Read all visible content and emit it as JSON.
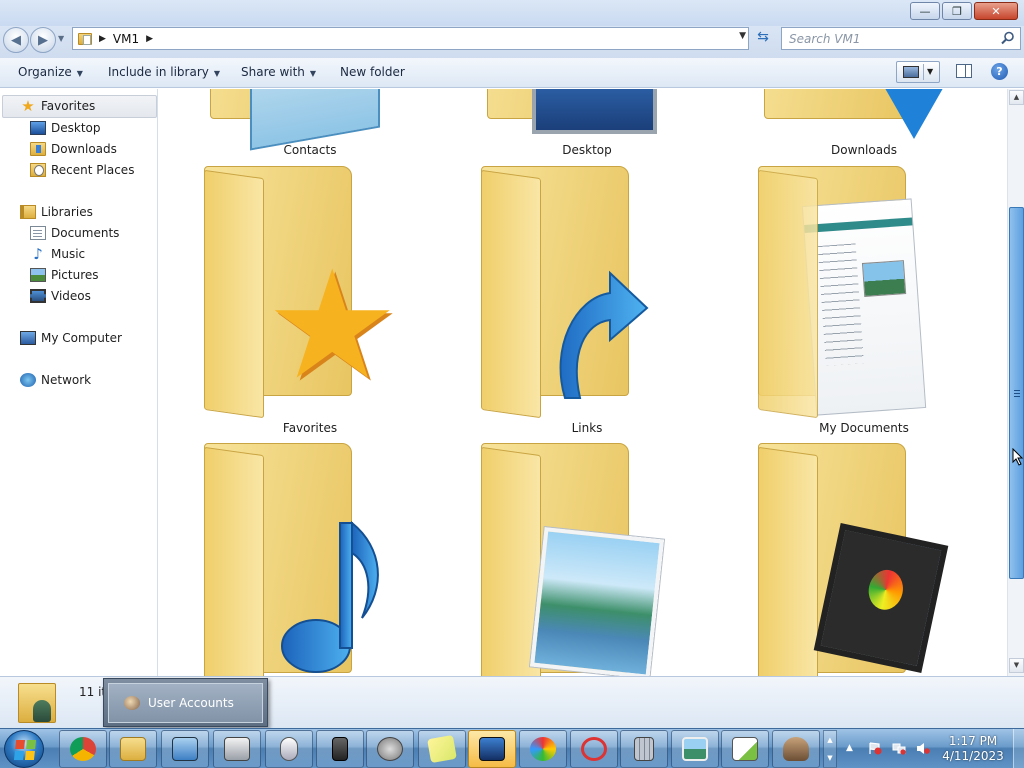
{
  "window": {
    "buttons": {
      "minimize": "—",
      "maximize": "❐",
      "close": "✕"
    }
  },
  "address_bar": {
    "breadcrumb": "VM1",
    "search_placeholder": "Search VM1"
  },
  "toolbar": {
    "organize": "Organize",
    "include_in_library": "Include in library",
    "share_with": "Share with",
    "new_folder": "New folder",
    "help": "?"
  },
  "nav_pane": {
    "favorites": {
      "label": "Favorites",
      "items": [
        {
          "label": "Desktop",
          "icon": "desktop-icon"
        },
        {
          "label": "Downloads",
          "icon": "downloads-folder-icon"
        },
        {
          "label": "Recent Places",
          "icon": "recent-places-icon"
        }
      ]
    },
    "libraries": {
      "label": "Libraries",
      "items": [
        {
          "label": "Documents",
          "icon": "documents-icon"
        },
        {
          "label": "Music",
          "icon": "music-note-icon"
        },
        {
          "label": "Pictures",
          "icon": "pictures-icon"
        },
        {
          "label": "Videos",
          "icon": "videos-icon"
        }
      ]
    },
    "computer": {
      "label": "My Computer"
    },
    "network": {
      "label": "Network"
    }
  },
  "content": {
    "items": [
      {
        "label": "Contacts"
      },
      {
        "label": "Desktop"
      },
      {
        "label": "Downloads"
      },
      {
        "label": "Favorites"
      },
      {
        "label": "Links"
      },
      {
        "label": "My Documents"
      },
      {
        "label": ""
      },
      {
        "label": ""
      },
      {
        "label": ""
      }
    ]
  },
  "details_pane": {
    "count_text": "11 it"
  },
  "taskbar_popup": {
    "label": "User Accounts"
  },
  "taskbar": {
    "pinned": [
      "chrome-icon",
      "explorer-icon",
      "control-panel-icon",
      "printer-icon",
      "mouse-icon",
      "computer-tower-icon",
      "speaker-icon",
      "sticky-notes-icon",
      "remote-desktop-icon",
      "paint-icon",
      "snipping-tool-icon",
      "calculator-icon",
      "photo-viewer-icon",
      "chart-tool-icon",
      "network-share-icon"
    ],
    "clock": {
      "time": "1:17 PM",
      "date": "4/11/2023"
    }
  },
  "colors": {
    "accent": "#4b7fb3",
    "folder": "#e8c561",
    "scrollbar_thumb": "#5d9fdf"
  }
}
